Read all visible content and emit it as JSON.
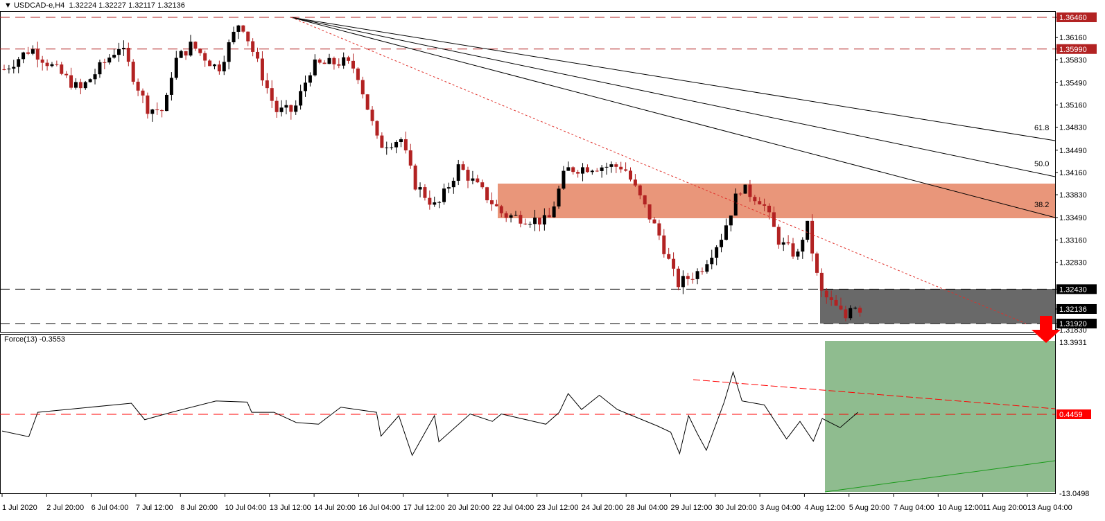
{
  "header": {
    "symbol": "USDCAD-e,H4",
    "ohlc": "1.32224 1.32227 1.32117 1.32136",
    "menu_icon": "triangle-down-icon"
  },
  "indicator": {
    "label": "Force(13) -0.3553"
  },
  "colors": {
    "bull": "#000000",
    "bear": "#b22222",
    "resistance_zone": "#e9967a",
    "support_zone": "#696969",
    "force_zone": "#8fbc8f",
    "level_line": "#b22222",
    "arrow": "#ff0000"
  },
  "chart_data": {
    "type": "candlestick",
    "title": "USDCAD-e,H4",
    "price_axis": {
      "min": 1.3183,
      "max": 1.3646,
      "ticks": [
        "1.36460",
        "1.36160",
        "1.35990",
        "1.35830",
        "1.35490",
        "1.35160",
        "1.34830",
        "1.34490",
        "1.34160",
        "1.33830",
        "1.33490",
        "1.33160",
        "1.32830",
        "1.32430",
        "1.32136",
        "1.31920",
        "1.31830"
      ]
    },
    "highlighted_levels": [
      {
        "label": "1.36460",
        "value": 1.3646
      },
      {
        "label": "1.35990",
        "value": 1.3599
      },
      {
        "label": "1.32430",
        "value": 1.3243
      },
      {
        "label": "1.31920",
        "value": 1.3192
      }
    ],
    "current_price": {
      "label": "1.32136",
      "value": 1.32136
    },
    "x_ticks": [
      "1 Jul 2020",
      "2 Jul 20:00",
      "6 Jul 04:00",
      "7 Jul 12:00",
      "8 Jul 20:00",
      "10 Jul 04:00",
      "13 Jul 12:00",
      "14 Jul 20:00",
      "16 Jul 04:00",
      "17 Jul 12:00",
      "20 Jul 20:00",
      "22 Jul 04:00",
      "23 Jul 12:00",
      "24 Jul 20:00",
      "28 Jul 04:00",
      "29 Jul 12:00",
      "30 Jul 20:00",
      "3 Aug 04:00",
      "4 Aug 12:00",
      "5 Aug 20:00",
      "7 Aug 04:00",
      "10 Aug 12:00",
      "11 Aug 20:00",
      "13 Aug 04:00"
    ],
    "price_path": [
      [
        0,
        1.3569
      ],
      [
        0.6,
        1.36
      ],
      [
        1.7,
        1.3538
      ],
      [
        2.6,
        1.3605
      ],
      [
        3.2,
        1.3512
      ],
      [
        3.6,
        1.3507
      ],
      [
        3.8,
        1.3579
      ],
      [
        4.2,
        1.3605
      ],
      [
        4.8,
        1.3569
      ],
      [
        5.3,
        1.3643
      ],
      [
        6.1,
        1.3507
      ],
      [
        6.5,
        1.3507
      ],
      [
        6.9,
        1.3574
      ],
      [
        7.6,
        1.358
      ],
      [
        7.9,
        1.3569
      ],
      [
        8.4,
        1.3456
      ],
      [
        8.9,
        1.3466
      ],
      [
        9.2,
        1.34
      ],
      [
        9.7,
        1.3363
      ],
      [
        10.2,
        1.3425
      ],
      [
        11.2,
        1.3353
      ],
      [
        12.2,
        1.3343
      ],
      [
        12.6,
        1.342
      ],
      [
        13.2,
        1.3425
      ],
      [
        13.9,
        1.3425
      ],
      [
        14.7,
        1.3322
      ],
      [
        15.1,
        1.325
      ],
      [
        15.6,
        1.327
      ],
      [
        16.1,
        1.3322
      ],
      [
        16.5,
        1.3394
      ],
      [
        17,
        1.3374
      ],
      [
        17.4,
        1.3312
      ],
      [
        17.8,
        1.3292
      ],
      [
        18,
        1.3343
      ],
      [
        18.3,
        1.324
      ],
      [
        18.9,
        1.3199
      ],
      [
        19,
        1.3225
      ],
      [
        19.2,
        1.3214
      ]
    ],
    "fibonacci": {
      "levels": [
        "38.2",
        "50.0",
        "61.8"
      ]
    },
    "force_index": {
      "name": "Force(13)",
      "value": -0.3553,
      "axis_ticks": [
        "13.3931",
        "0.4459",
        "-13.0498"
      ],
      "level": 0.4459,
      "path": [
        [
          0,
          -2.5
        ],
        [
          0.6,
          -3.5
        ],
        [
          0.8,
          0.8
        ],
        [
          2.9,
          2.4
        ],
        [
          3.2,
          -0.5
        ],
        [
          3.8,
          0.8
        ],
        [
          4.8,
          2.8
        ],
        [
          5.5,
          2.6
        ],
        [
          5.6,
          0.8
        ],
        [
          6.1,
          0.8
        ],
        [
          6.6,
          -1.0
        ],
        [
          7.1,
          -1.3
        ],
        [
          7.6,
          1.7
        ],
        [
          8.4,
          0.8
        ],
        [
          8.5,
          -3.4
        ],
        [
          8.9,
          0.2
        ],
        [
          9.2,
          -6.8
        ],
        [
          9.7,
          0.2
        ],
        [
          9.8,
          -4.4
        ],
        [
          10.5,
          0.5
        ],
        [
          11,
          -0.8
        ],
        [
          11.2,
          0.5
        ],
        [
          12.2,
          -1.3
        ],
        [
          12.5,
          0.8
        ],
        [
          12.7,
          4.1
        ],
        [
          13,
          1.3
        ],
        [
          13.4,
          3.8
        ],
        [
          13.8,
          1.3
        ],
        [
          14.7,
          -1.6
        ],
        [
          15,
          -2.7
        ],
        [
          15.2,
          -6.5
        ],
        [
          15.4,
          0.2
        ],
        [
          15.6,
          -3.0
        ],
        [
          15.8,
          -5.9
        ],
        [
          16.2,
          2.6
        ],
        [
          16.4,
          7.9
        ],
        [
          16.6,
          2.8
        ],
        [
          17.1,
          2.1
        ],
        [
          17.6,
          -3.9
        ],
        [
          17.9,
          -0.8
        ],
        [
          18.2,
          -4.3
        ],
        [
          18.4,
          -0.3
        ],
        [
          18.8,
          -1.9
        ],
        [
          19.2,
          0.8
        ]
      ]
    }
  }
}
